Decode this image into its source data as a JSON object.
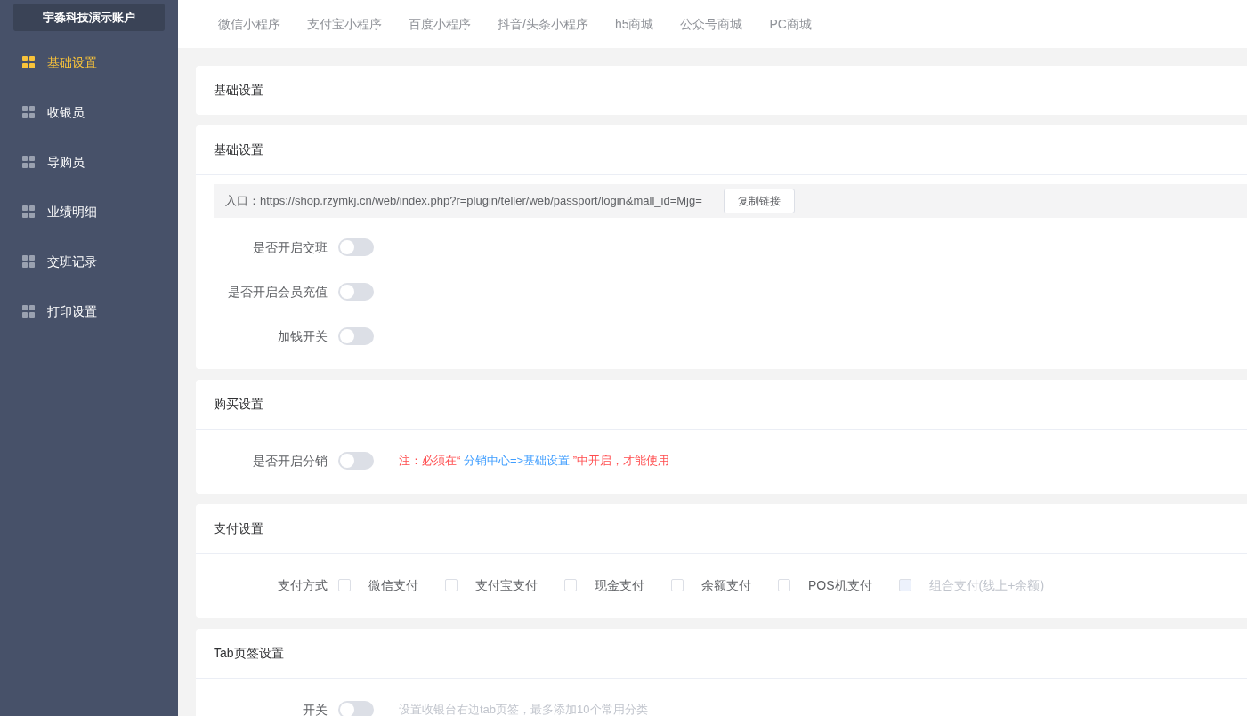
{
  "sidebar": {
    "account": "宇淼科技演示账户",
    "items": [
      {
        "label": "基础设置",
        "selected": true
      },
      {
        "label": "收银员",
        "selected": false
      },
      {
        "label": "导购员",
        "selected": false
      },
      {
        "label": "业绩明细",
        "selected": false
      },
      {
        "label": "交班记录",
        "selected": false
      },
      {
        "label": "打印设置",
        "selected": false
      }
    ]
  },
  "top_tabs": [
    "微信小程序",
    "支付宝小程序",
    "百度小程序",
    "抖音/头条小程序",
    "h5商城",
    "公众号商城",
    "PC商城"
  ],
  "sections": [
    {
      "title": "基础设置"
    },
    {
      "title": "基础设置",
      "rows": [
        {
          "kind": "entry",
          "label": "入口：",
          "url": "https://shop.rzymkj.cn/web/index.php?r=plugin/teller/web/passport/login&mall_id=Mjg=",
          "button": "复制链接"
        },
        {
          "kind": "switch",
          "label": "是否开启交班",
          "on": false
        },
        {
          "kind": "switch",
          "label": "是否开启会员充值",
          "on": false
        },
        {
          "kind": "switch",
          "label": "加钱开关",
          "on": false
        }
      ]
    },
    {
      "title": "购买设置",
      "rows": [
        {
          "kind": "switch",
          "label": "是否开启分销",
          "on": false,
          "note": {
            "kind": "warning",
            "before": "注：必须在“ ",
            "link": "分销中心=>基础设置",
            "after": " ”中开启，才能使用"
          }
        }
      ]
    },
    {
      "title": "支付设置",
      "rows": [
        {
          "kind": "checkboxes",
          "label": "支付方式",
          "options": [
            {
              "label": "微信支付",
              "checked": false,
              "disabled": false
            },
            {
              "label": "支付宝支付",
              "checked": false,
              "disabled": false
            },
            {
              "label": "现金支付",
              "checked": false,
              "disabled": false
            },
            {
              "label": "余额支付",
              "checked": false,
              "disabled": false
            },
            {
              "label": "POS机支付",
              "checked": false,
              "disabled": false
            },
            {
              "label": "组合支付(线上+余额)",
              "checked": false,
              "disabled": true
            }
          ]
        }
      ]
    },
    {
      "title": "Tab页签设置",
      "rows": [
        {
          "kind": "switch",
          "label": "开关",
          "on": false,
          "note": {
            "kind": "hint",
            "before": "设置收银台右边tab页签，最多添加10个常用分类"
          }
        }
      ]
    }
  ]
}
